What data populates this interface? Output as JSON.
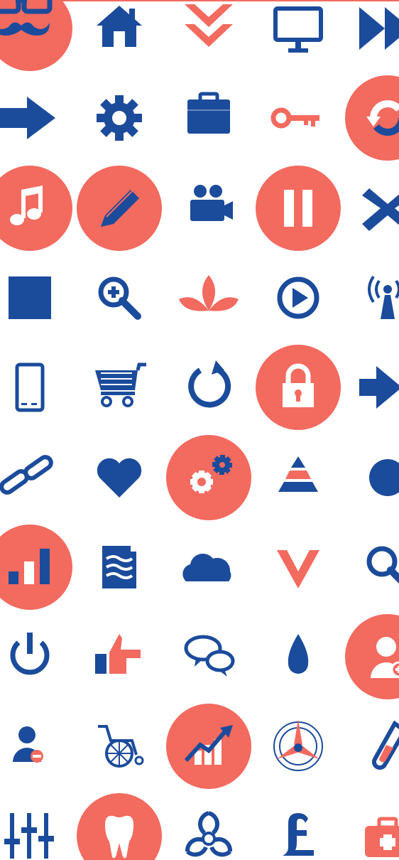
{
  "palette": {
    "blue": "#1b4b9b",
    "coral": "#f36a5f",
    "white": "#ffffff"
  },
  "icons": [
    "hipster-mustache-icon",
    "home-icon",
    "double-chevron-down-icon",
    "monitor-icon",
    "fast-forward-icon",
    "arrow-right-icon",
    "gear-icon",
    "briefcase-icon",
    "key-icon",
    "refresh-icon",
    "music-note-icon",
    "pencil-icon",
    "video-camera-icon",
    "pause-icon",
    "close-icon",
    "stop-icon",
    "zoom-in-icon",
    "lotus-icon",
    "play-icon",
    "broadcast-icon",
    "smartphone-icon",
    "shopping-cart-icon",
    "reload-icon",
    "padlock-icon",
    "arrow-right-icon-2",
    "link-icon",
    "heart-icon",
    "gears-icon",
    "pyramid-icon",
    "circle-icon",
    "bar-chart-icon",
    "document-icon",
    "cloud-icon",
    "checkmark-icon",
    "search-icon",
    "power-icon",
    "thumbs-up-pointing-icon",
    "chat-bubbles-icon",
    "water-drop-icon",
    "user-add-icon",
    "user-remove-icon",
    "wheelchair-icon",
    "growth-chart-icon",
    "compass-icon",
    "test-tube-icon",
    "equalizer-icon",
    "tooth-icon",
    "biohazard-icon",
    "pound-sign-icon",
    "first-aid-kit-icon"
  ],
  "coral_circle_icons": [
    "hipster-mustache-icon",
    "refresh-icon",
    "music-note-icon",
    "pencil-icon",
    "pause-icon",
    "padlock-icon",
    "gears-icon",
    "bar-chart-icon",
    "user-add-icon",
    "growth-chart-icon",
    "tooth-icon"
  ]
}
